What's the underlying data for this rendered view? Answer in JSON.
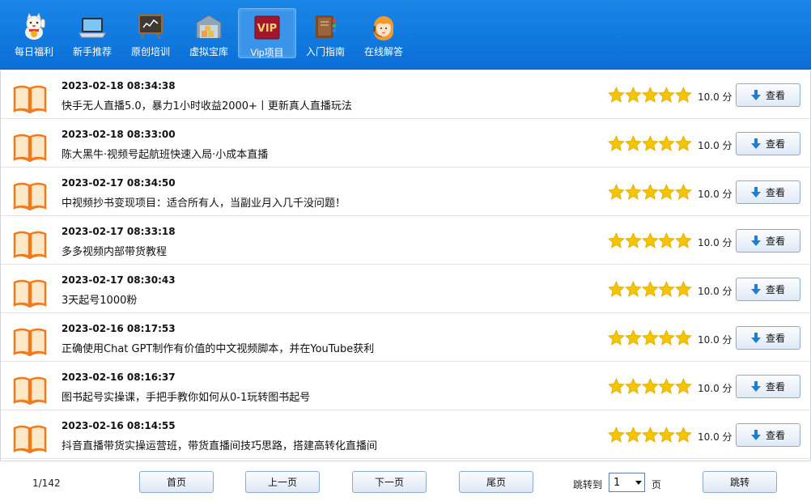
{
  "nav": {
    "items": [
      {
        "label": "每日福利",
        "icon": "lucky-cat-icon"
      },
      {
        "label": "新手推荐",
        "icon": "laptop-icon"
      },
      {
        "label": "原创培训",
        "icon": "chalkboard-icon"
      },
      {
        "label": "虚拟宝库",
        "icon": "warehouse-icon"
      },
      {
        "label": "Vip项目",
        "icon": "vip-icon",
        "active": true,
        "badge": "VIP"
      },
      {
        "label": "入门指南",
        "icon": "books-icon"
      },
      {
        "label": "在线解答",
        "icon": "support-agent-icon"
      }
    ]
  },
  "list": {
    "rating_stars": 5,
    "rows": [
      {
        "date": "2023-02-18 08:34:38",
        "title": "快手无人直播5.0，暴力1小时收益2000+丨更新真人直播玩法",
        "score": "10.0 分",
        "button": "查看"
      },
      {
        "date": "2023-02-18 08:33:00",
        "title": "陈大黑牛·视频号起航班快速入局·小成本直播",
        "score": "10.0 分",
        "button": "查看"
      },
      {
        "date": "2023-02-17 08:34:50",
        "title": "中视频抄书变现项目：适合所有人，当副业月入几千没问题！",
        "score": "10.0 分",
        "button": "查看"
      },
      {
        "date": "2023-02-17 08:33:18",
        "title": "多多视频内部带货教程",
        "score": "10.0 分",
        "button": "查看"
      },
      {
        "date": "2023-02-17 08:30:43",
        "title": "3天起号1000粉",
        "score": "10.0 分",
        "button": "查看"
      },
      {
        "date": "2023-02-16 08:17:53",
        "title": "正确使用Chat GPT制作有价值的中文视频脚本，并在YouTube获利",
        "score": "10.0 分",
        "button": "查看"
      },
      {
        "date": "2023-02-16 08:16:37",
        "title": "图书起号实操课，手把手教你如何从0-1玩转图书起号",
        "score": "10.0 分",
        "button": "查看"
      },
      {
        "date": "2023-02-16 08:14:55",
        "title": "抖音直播带货实操运营班，带货直播间技巧思路，搭建高转化直播间",
        "score": "10.0 分",
        "button": "查看"
      }
    ]
  },
  "pager": {
    "page_info": "1/142",
    "first": "首页",
    "prev": "上一页",
    "next": "下一页",
    "last": "尾页",
    "jump_label": "跳转到",
    "jump_value": "1",
    "page_unit": "页",
    "jump_button": "跳转"
  },
  "colors": {
    "topbar": "#0a6fd8",
    "star": "#f5c400",
    "book": "#f07a1e"
  }
}
